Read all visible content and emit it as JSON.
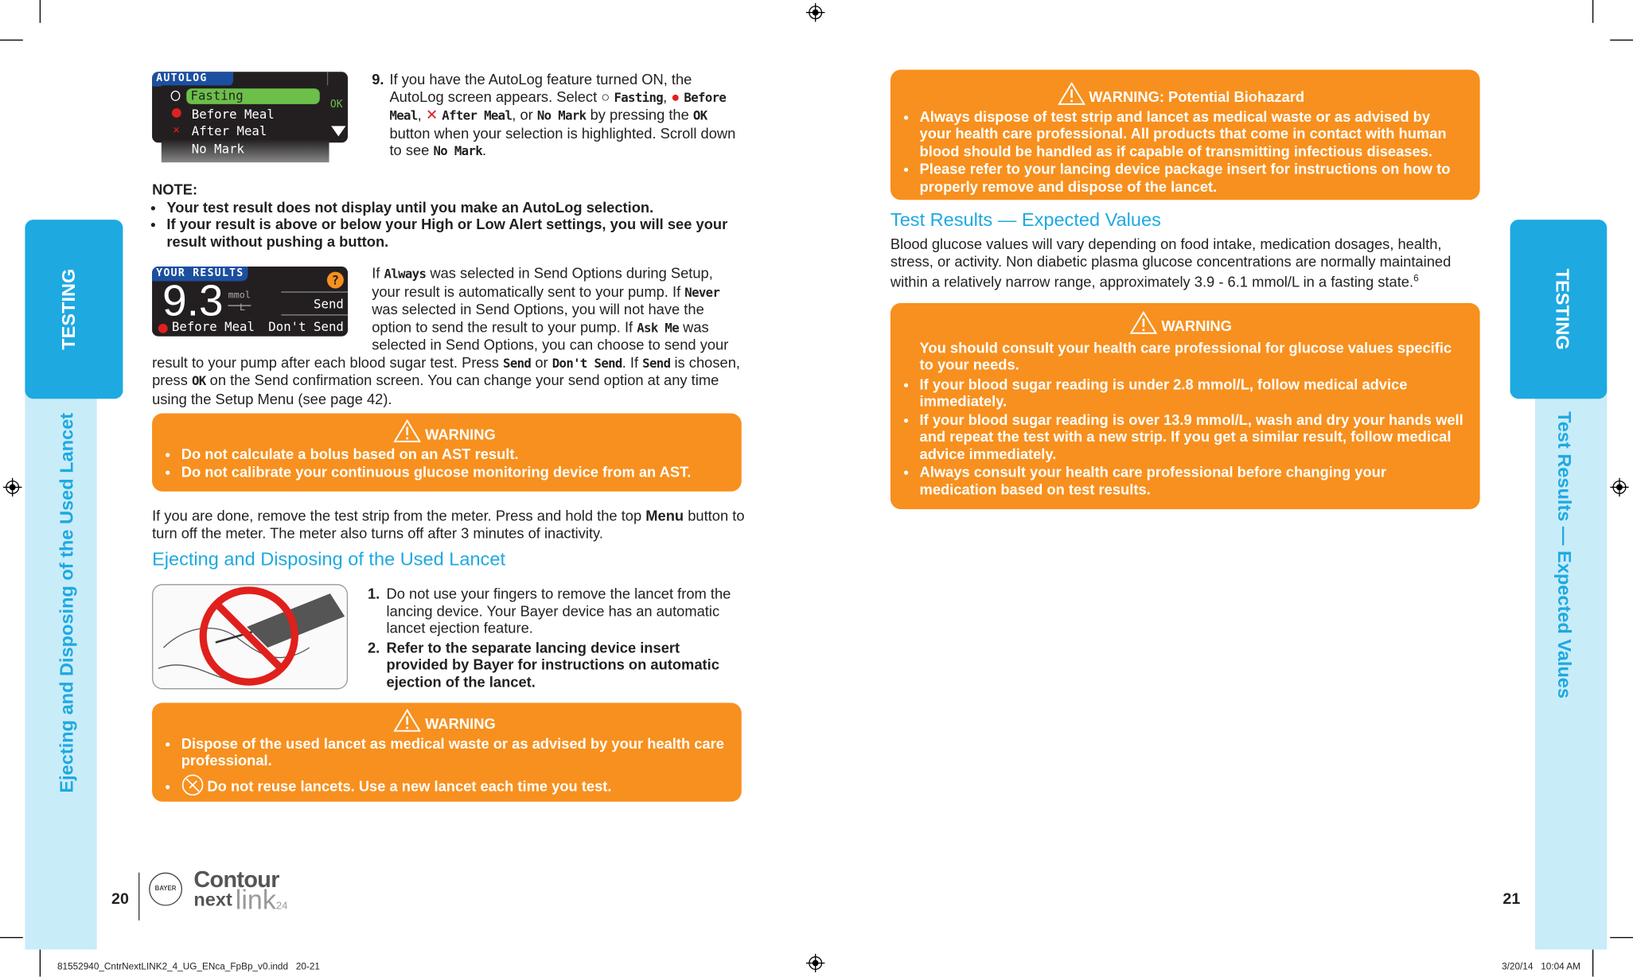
{
  "left_page": {
    "tab_label": "TESTING",
    "side_label": "Ejecting and Disposing of the Used Lancet",
    "autolog_screen": {
      "title": "AUTOLOG",
      "options": [
        "Fasting",
        "Before Meal",
        "After Meal",
        "No Mark"
      ],
      "selected": "Fasting",
      "ok_label": "OK"
    },
    "step9": {
      "number": "9.",
      "t1": "If you have the AutoLog feature turned ON, the AutoLog screen appears. Select ",
      "fasting": "Fasting",
      "before": "Before Meal",
      "after": "After Meal",
      "or": ", or ",
      "nomark": "No Mark",
      "t2": " by pressing the ",
      "ok": "OK",
      "t3": " button when your selection is highlighted. Scroll down to see ",
      "nomark2": "No Mark",
      "end": "."
    },
    "note": {
      "title": "NOTE:",
      "items": [
        "Your test result does not display until you make an AutoLog selection.",
        "If your result is above or below your High or Low Alert settings, you will see your result without pushing a button."
      ]
    },
    "results_screen": {
      "title": "YOUR RESULTS",
      "value": "9.3",
      "unit_top": "mmol",
      "unit_bottom": "L",
      "help": "?",
      "send": "Send",
      "dont_send": "Don't Send",
      "tag": "Before Meal"
    },
    "send_para": {
      "a": "If ",
      "always": "Always",
      "b": " was selected in Send Options during Setup, your result is automatically sent to your pump. If ",
      "never": "Never",
      "c": " was selected in Send Options, you will not have the option to send the result to your pump. If ",
      "askme": "Ask Me",
      "d": " was selected in Send Options, you can choose to send your result to your pump after each blood sugar test. Press ",
      "send": "Send",
      "e": " or ",
      "dontsend": "Don't Send",
      "f": ". If ",
      "send2": "Send",
      "g": " is chosen, press ",
      "ok": "OK",
      "h": " on the Send confirmation screen. You can change your send option at any time using the Setup Menu (see page 42)."
    },
    "warning1": {
      "title": "WARNING",
      "items": [
        "Do not calculate a bolus based on an AST result.",
        "Do not calibrate your continuous glucose monitoring device from an AST."
      ]
    },
    "done_para": {
      "a": "If you are done, remove the test strip from the meter. Press and hold the top ",
      "menu": "Menu",
      "b": " button to turn off the meter. The meter also turns off after 3 minutes of inactivity."
    },
    "section_heading": "Ejecting and Disposing of the Used Lancet",
    "steps": [
      {
        "num": "1.",
        "text": "Do not use your fingers to remove the lancet from the lancing device. Your Bayer device has an automatic lancet ejection feature."
      },
      {
        "num": "2.",
        "text": "Refer to the separate lancing device insert provided by Bayer for instructions on automatic ejection of the lancet."
      }
    ],
    "warning2": {
      "title": "WARNING",
      "items": [
        "Dispose of the used lancet as medical waste or as advised by your health care professional.",
        "Do not reuse lancets. Use a new lancet each time you test."
      ]
    },
    "page_number": "20",
    "logo": {
      "bayer": "BAYER",
      "contour": "Contour",
      "next": "next",
      "link": "link",
      "sub": "24"
    }
  },
  "right_page": {
    "tab_label": "TESTING",
    "side_label": "Test Results — Expected Values",
    "biohazard": {
      "title": "WARNING: Potential Biohazard",
      "items": [
        "Always dispose of test strip and lancet as medical waste or as advised by your health care professional. All products that come in contact with human blood should be handled as if capable of transmitting infectious diseases.",
        "Please refer to your lancing device package insert for instructions on how to properly remove and dispose of the lancet."
      ]
    },
    "heading": "Test Results — Expected Values",
    "para": "Blood glucose values will vary depending on food intake, medication dosages, health, stress, or activity. Non diabetic plasma glucose concentrations are normally maintained within a relatively narrow range, approximately 3.9 - 6.1 mmol/L in a fasting state.",
    "para_sup": "6",
    "warning": {
      "title": "WARNING",
      "intro": "You should consult your health care professional for glucose values specific to your needs.",
      "items": [
        "If your blood sugar reading is under 2.8 mmol/L, follow medical advice immediately.",
        "If your blood sugar reading is over 13.9 mmol/L, wash and dry your hands well and repeat the test with a new strip. If you get a similar result, follow medical advice immediately.",
        "Always consult your health care professional before changing your medication based on test results."
      ]
    },
    "page_number": "21"
  },
  "slug": {
    "file": "81552940_CntrNextLINK2_4_UG_ENca_FpBp_v0.indd   20-21",
    "date": "3/20/14   10:04 AM"
  },
  "colors": {
    "accent_blue": "#1ea9e1",
    "light_blue": "#c9ecf9",
    "warning_orange": "#f7901e",
    "screen_green": "#6cc04a"
  }
}
